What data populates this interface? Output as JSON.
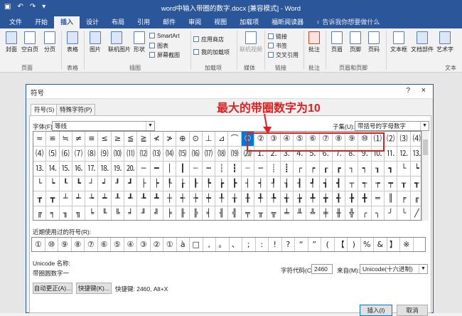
{
  "window": {
    "title": "word中输入带圈的数字.docx [兼容模式] - Word",
    "quick_access": [
      "save",
      "undo",
      "redo",
      "customize"
    ]
  },
  "ribbon_tabs": [
    "文件",
    "开始",
    "插入",
    "设计",
    "布局",
    "引用",
    "邮件",
    "审阅",
    "视图",
    "加载项",
    "福昕阅读器"
  ],
  "active_tab": "插入",
  "tell_me": "♀ 告诉我你想要做什么",
  "ribbon": {
    "buttons": {
      "cover": "封面",
      "blank": "空白页",
      "pagebreak": "分页",
      "table": "表格",
      "picture": "图片",
      "online_picture": "联机图片",
      "shapes": "形状",
      "online_video": "联机视频",
      "link": "链接",
      "bookmark": "书签",
      "crossref": "交叉引用",
      "comment": "批注",
      "header": "页眉",
      "footer": "页脚",
      "pagenum": "页码",
      "textbox": "文本框",
      "docparts": "文档部件",
      "wordart": "艺术字"
    },
    "small": {
      "smartart": "SmartArt",
      "chart": "图表",
      "screenshot": "屏幕截图",
      "store": "应用商店",
      "myaddins": "我的加载项"
    },
    "groups": [
      "页面",
      "表格",
      "插图",
      "加载项",
      "媒体",
      "链接",
      "批注",
      "页眉和页脚",
      "文本"
    ]
  },
  "dialog": {
    "title": "符号",
    "help": "?",
    "close": "×",
    "tabs": [
      "符号(S)",
      "特殊字符(P)"
    ],
    "font_label": "字体(F):",
    "font_value": "等线",
    "subset_label": "子集(U):",
    "subset_value": "带括号的字母数字",
    "symbol_rows": [
      [
        "≈",
        "≌",
        "≒",
        "≠",
        "≡",
        "≤",
        "≥",
        "≦",
        "≧",
        "≮",
        "≯",
        "⊕",
        "⊙",
        "⊥",
        "⊿",
        "⌒",
        "①",
        "②",
        "③",
        "④",
        "⑤",
        "⑥",
        "⑦",
        "⑧",
        "⑨",
        "⑩",
        "⑴",
        "⑵",
        "⑶",
        "⑷"
      ],
      [
        "⑷",
        "⑸",
        "⑹",
        "⑺",
        "⑻",
        "⑼",
        "⑽",
        "⑾",
        "⑿",
        "⒀",
        "⒁",
        "⒂",
        "⒃",
        "⒄",
        "⒅",
        "⒆",
        "⒇",
        "⒈",
        "⒉",
        "⒊",
        "⒋",
        "⒌",
        "⒍",
        "⒎",
        "⒏",
        "⒐",
        "⒑",
        "⒒",
        "⒓",
        "⒔"
      ],
      [
        "⒔",
        "⒕",
        "⒖",
        "⒗",
        "⒘",
        "⒙",
        "⒚",
        "⒛",
        "─",
        "━",
        "│",
        "┃",
        "┄",
        "┅",
        "┆",
        "┇",
        "┈",
        "┉",
        "┊",
        "┋",
        "┌",
        "┍",
        "┎",
        "┏",
        "┐",
        "┑",
        "┒",
        "┓",
        "└",
        "┕"
      ],
      [
        "└",
        "┕",
        "┖",
        "┗",
        "┘",
        "┙",
        "┚",
        "┛",
        "├",
        "┝",
        "┞",
        "┟",
        "┠",
        "┡",
        "┢",
        "┣",
        "┤",
        "┥",
        "┦",
        "┧",
        "┨",
        "┩",
        "┪",
        "┫",
        "┬",
        "┭",
        "┮",
        "┯",
        "┰",
        "┱"
      ],
      [
        "┲",
        "┳",
        "┴",
        "┵",
        "┶",
        "┷",
        "┸",
        "┹",
        "┺",
        "┻",
        "┼",
        "┽",
        "┾",
        "┿",
        "╀",
        "╁",
        "╂",
        "╃",
        "╄",
        "╅",
        "╆",
        "╇",
        "╈",
        "╉",
        "╊",
        "╋",
        "═",
        "║",
        "╒",
        "╓"
      ],
      [
        "╔",
        "╕",
        "╖",
        "╗",
        "╘",
        "╙",
        "╚",
        "╛",
        "╜",
        "╝",
        "╞",
        "╟",
        "╠",
        "╡",
        "╢",
        "╣",
        "╤",
        "╥",
        "╦",
        "╧",
        "╨",
        "╩",
        "╪",
        "╫",
        "╬",
        "╭",
        "╮",
        "╯",
        "╰",
        "╱"
      ]
    ],
    "selected_symbol": "①",
    "recent_label": "近期使用过的符号(R):",
    "recent_symbols": [
      "①",
      "⑩",
      "⑨",
      "⑧",
      "⑦",
      "⑥",
      "⑤",
      "④",
      "③",
      "②",
      "①",
      "à",
      "□",
      ",",
      "。",
      "、",
      ";",
      ":",
      "!",
      "?",
      "“",
      "”",
      "(",
      "【",
      ")",
      "%",
      "&",
      "】",
      "※"
    ],
    "unicode_name_label": "Unicode 名称:",
    "unicode_name_value": "带圈圆数字一",
    "charcode_label": "字符代码(C):",
    "charcode_value": "2460",
    "from_label": "来自(M):",
    "from_value": "Unicode(十六进制)",
    "autocorrect_btn": "自动更正(A)...",
    "shortcut_btn": "快捷键(K)...",
    "shortcut_text": "快捷键: 2460, Alt+X",
    "insert_btn": "插入(I)",
    "cancel_btn": "取消"
  },
  "annotation": "最大的带圈数字为10",
  "colors": {
    "word_blue": "#2b579a",
    "annotation_red": "#e02020",
    "selection_blue": "#0078d7"
  }
}
